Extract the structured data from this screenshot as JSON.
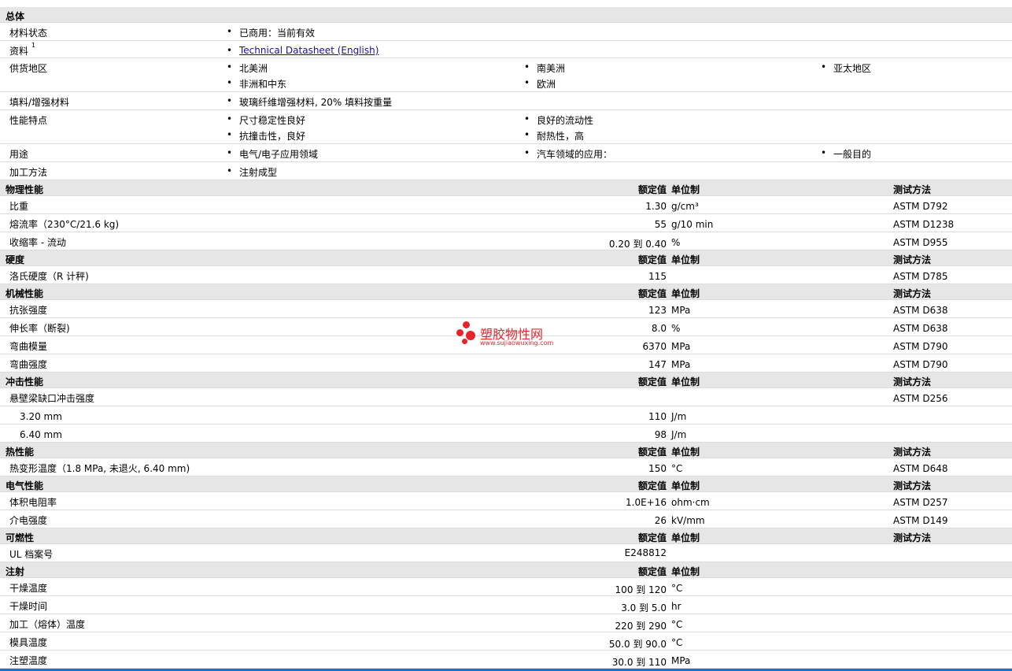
{
  "general": {
    "title": "总体",
    "material_status": {
      "label": "材料状态",
      "value": "已商用：当前有效"
    },
    "info": {
      "label": "资料",
      "sup": "1",
      "link": "Technical Datasheet (English)"
    },
    "regions": {
      "label": "供货地区",
      "items": [
        "北美洲",
        "南美洲",
        "亚太地区",
        "非洲和中东",
        "欧洲"
      ]
    },
    "filler": {
      "label": "填料/增强材料",
      "value": "玻璃纤维增强材料, 20% 填料按重量"
    },
    "features": {
      "label": "性能特点",
      "items": [
        "尺寸稳定性良好",
        "良好的流动性",
        "抗撞击性，良好",
        "耐热性，高"
      ]
    },
    "uses": {
      "label": "用途",
      "items": [
        "电气/电子应用领域",
        "汽车领域的应用：",
        "一般目的"
      ]
    },
    "processing": {
      "label": "加工方法",
      "value": "注射成型"
    }
  },
  "headers": {
    "value": "额定值",
    "unit": "单位制",
    "test": "测试方法"
  },
  "physical": {
    "title": "物理性能",
    "rows": [
      {
        "label": "比重",
        "value": "1.30",
        "unit": "g/cm³",
        "test": "ASTM D792"
      },
      {
        "label": "熔流率（230°C/21.6 kg)",
        "value": "55",
        "unit": "g/10 min",
        "test": "ASTM D1238"
      },
      {
        "label": "收缩率 - 流动",
        "value": "0.20 到  0.40",
        "unit": "%",
        "test": "ASTM D955"
      }
    ]
  },
  "hardness": {
    "title": "硬度",
    "rows": [
      {
        "label": "洛氏硬度（R 计秤)",
        "value": "115",
        "unit": "",
        "test": "ASTM D785"
      }
    ]
  },
  "mechanical": {
    "title": "机械性能",
    "rows": [
      {
        "label": "抗张强度",
        "value": "123",
        "unit": "MPa",
        "test": "ASTM D638"
      },
      {
        "label": "伸长率（断裂)",
        "value": "8.0",
        "unit": "%",
        "test": "ASTM D638"
      },
      {
        "label": "弯曲模量",
        "value": "6370",
        "unit": "MPa",
        "test": "ASTM D790"
      },
      {
        "label": "弯曲强度",
        "value": "147",
        "unit": "MPa",
        "test": "ASTM D790"
      }
    ]
  },
  "impact": {
    "title": "冲击性能",
    "main": {
      "label": "悬壁梁缺口冲击强度",
      "test": "ASTM D256"
    },
    "rows": [
      {
        "label": "3.20 mm",
        "value": "110",
        "unit": "J/m"
      },
      {
        "label": "6.40 mm",
        "value": "98",
        "unit": "J/m"
      }
    ]
  },
  "thermal": {
    "title": "热性能",
    "rows": [
      {
        "label": "热变形温度（1.8 MPa, 未退火, 6.40 mm)",
        "value": "150",
        "unit": "°C",
        "test": "ASTM D648"
      }
    ]
  },
  "electrical": {
    "title": "电气性能",
    "rows": [
      {
        "label": "体积电阻率",
        "value": "1.0E+16",
        "unit": "ohm·cm",
        "test": "ASTM D257"
      },
      {
        "label": "介电强度",
        "value": "26",
        "unit": "kV/mm",
        "test": "ASTM D149"
      }
    ]
  },
  "flammability": {
    "title": "可燃性",
    "rows": [
      {
        "label": "UL 档案号",
        "value": "E248812"
      }
    ]
  },
  "injection": {
    "title": "注射",
    "rows": [
      {
        "label": "干燥温度",
        "value": "100 到  120",
        "unit": "°C"
      },
      {
        "label": "干燥时间",
        "value": "3.0 到  5.0",
        "unit": "hr"
      },
      {
        "label": "加工（熔体）温度",
        "value": "220 到  290",
        "unit": "°C"
      },
      {
        "label": "模具温度",
        "value": "50.0 到  90.0",
        "unit": "°C"
      },
      {
        "label": "注塑温度",
        "value": "30.0 到  110",
        "unit": "MPa"
      }
    ]
  },
  "watermark": {
    "title": "塑胶物性网",
    "url": "www.sujiaowuxing.com",
    "color": "#e8232b"
  }
}
